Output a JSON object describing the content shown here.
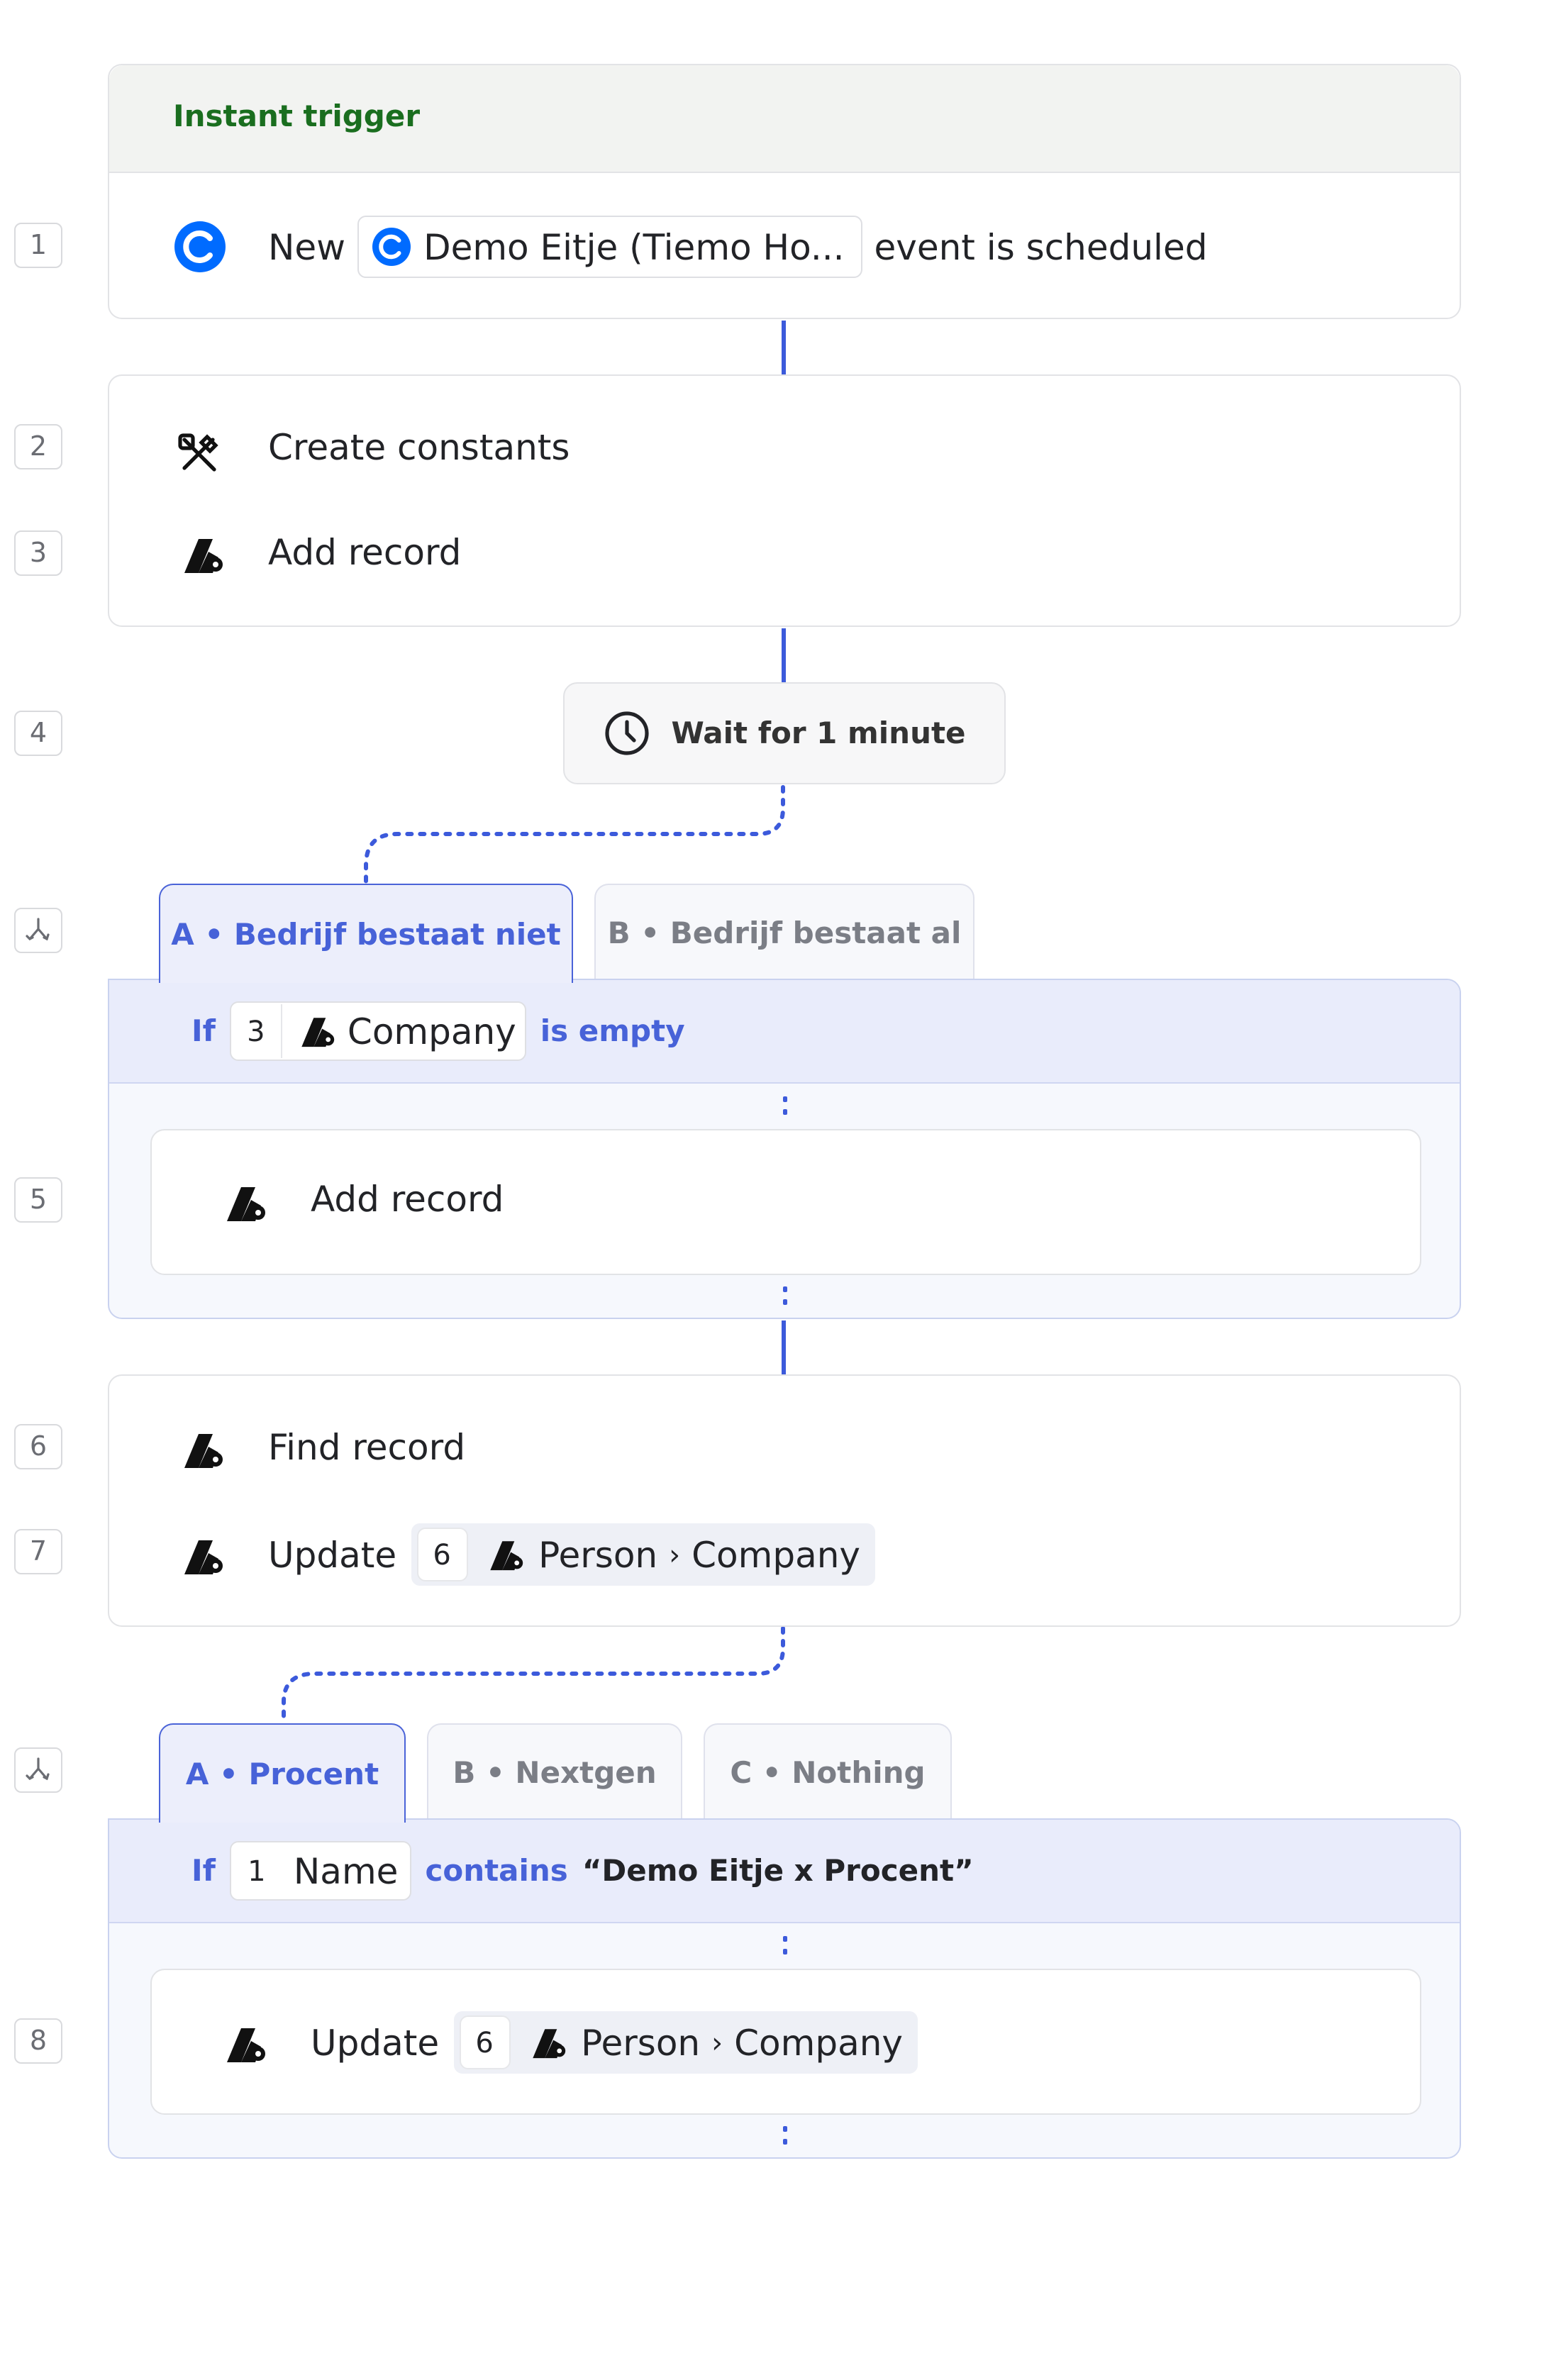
{
  "trigger": {
    "header": "Instant trigger",
    "step": "1",
    "prefix": "New",
    "chip": "Demo Eitje (Tiemo Ho...",
    "suffix": "event is scheduled"
  },
  "group1": {
    "steps": [
      {
        "num": "2",
        "label": "Create constants",
        "icon": "tools-icon"
      },
      {
        "num": "3",
        "label": "Add record",
        "icon": "attio-icon"
      }
    ]
  },
  "wait": {
    "num": "4",
    "label": "Wait for 1 minute",
    "icon": "clock-icon"
  },
  "branch1": {
    "tabs": [
      {
        "label": "A • Bedrijf bestaat niet",
        "active": true
      },
      {
        "label": "B • Bedrijf bestaat al",
        "active": false
      }
    ],
    "condition": {
      "if": "If",
      "ref_num": "3",
      "field": "Company",
      "operator": "is empty"
    },
    "step": {
      "num": "5",
      "label": "Add record"
    }
  },
  "group2": {
    "find": {
      "num": "6",
      "label": "Find record"
    },
    "update": {
      "num": "7",
      "label": "Update",
      "ref_num": "6",
      "path1": "Person",
      "sep": "›",
      "path2": "Company"
    }
  },
  "branch2": {
    "tabs": [
      {
        "label": "A • Procent",
        "active": true
      },
      {
        "label": "B • Nextgen",
        "active": false
      },
      {
        "label": "C • Nothing",
        "active": false
      }
    ],
    "condition": {
      "if": "If",
      "ref_num": "1",
      "field": "Name",
      "operator": "contains",
      "value": "“Demo Eitje x Procent”"
    },
    "step": {
      "num": "8",
      "label": "Update",
      "ref_num": "6",
      "path1": "Person",
      "sep": "›",
      "path2": "Company"
    }
  },
  "colors": {
    "accent": "#4762d8",
    "line": "#3c5adb",
    "trigger_green": "#1a6e1f",
    "calendly": "#006bff"
  }
}
